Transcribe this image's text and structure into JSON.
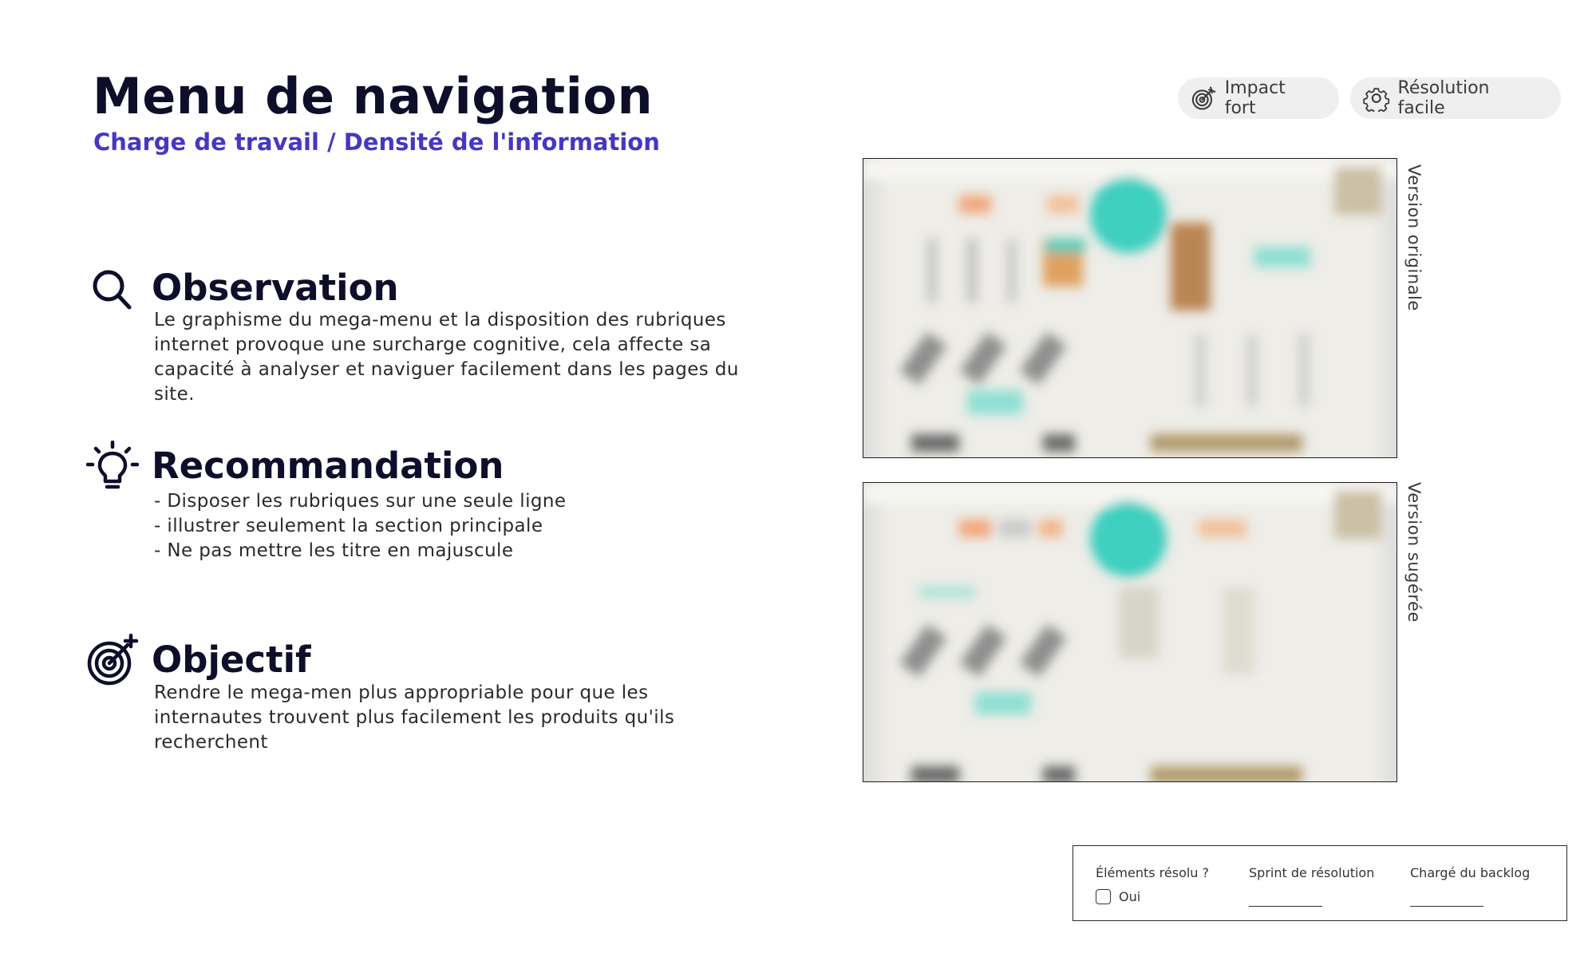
{
  "header": {
    "title": "Menu de navigation",
    "subtitle": "Charge de travail / Densité de l'information"
  },
  "tags": {
    "impact": {
      "label": "Impact fort",
      "icon": "target-icon"
    },
    "resolution": {
      "label": "Résolution facile",
      "icon": "gear-icon"
    }
  },
  "sections": {
    "observation": {
      "heading": "Observation",
      "icon": "search-icon",
      "text": "Le graphisme du mega-menu et la disposition des rubriques internet provoque une surcharge cognitive, cela affecte sa capacité à analyser et naviguer facilement dans les pages du site."
    },
    "recommendation": {
      "heading": "Recommandation",
      "icon": "lightbulb-icon",
      "items": [
        "- Disposer les rubriques sur une seule ligne",
        "- illustrer seulement la section principale",
        "- Ne pas mettre les titre en majuscule"
      ]
    },
    "objective": {
      "heading": "Objectif",
      "icon": "target-icon",
      "text": "Rendre le mega-men plus appropriable pour que les internautes trouvent plus facilement les produits qu'ils recherchent"
    }
  },
  "screenshots": {
    "original_label": "Version originale",
    "suggested_label": "Version sugérée"
  },
  "status": {
    "resolved_label": "Éléments résolu ?",
    "checkbox_label": "Oui",
    "checkbox_checked": false,
    "sprint_label": "Sprint de résolution",
    "owner_label": "Chargé du backlog"
  },
  "colors": {
    "title": "#0e0e2a",
    "subtitle": "#4636c4",
    "tag_background": "#efefef",
    "mockup_accent": "#3ecfbf"
  }
}
